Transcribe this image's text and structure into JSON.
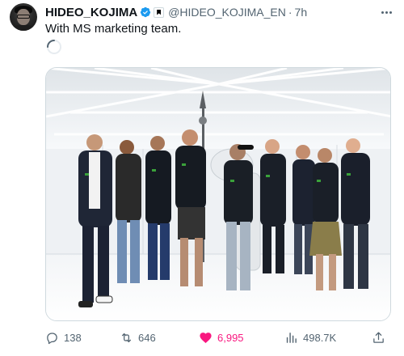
{
  "author": {
    "name": "HIDEO_KOJIMA",
    "handle": "@HIDEO_KOJIMA_EN",
    "separator": "·",
    "time": "7h"
  },
  "tweet": {
    "text": "With MS marketing team."
  },
  "actions": {
    "replies": "138",
    "reposts": "646",
    "likes": "6,995",
    "views": "498.7K"
  },
  "colors": {
    "verified": "#1d9bf0",
    "like": "#f91880",
    "muted": "#536471",
    "text": "#0f1419"
  },
  "icons": [
    "avatar",
    "verified-badge-icon",
    "affiliate-badge-icon",
    "more-icon",
    "loading-spinner-icon",
    "reply-icon",
    "repost-icon",
    "heart-icon",
    "views-icon",
    "share-icon"
  ]
}
